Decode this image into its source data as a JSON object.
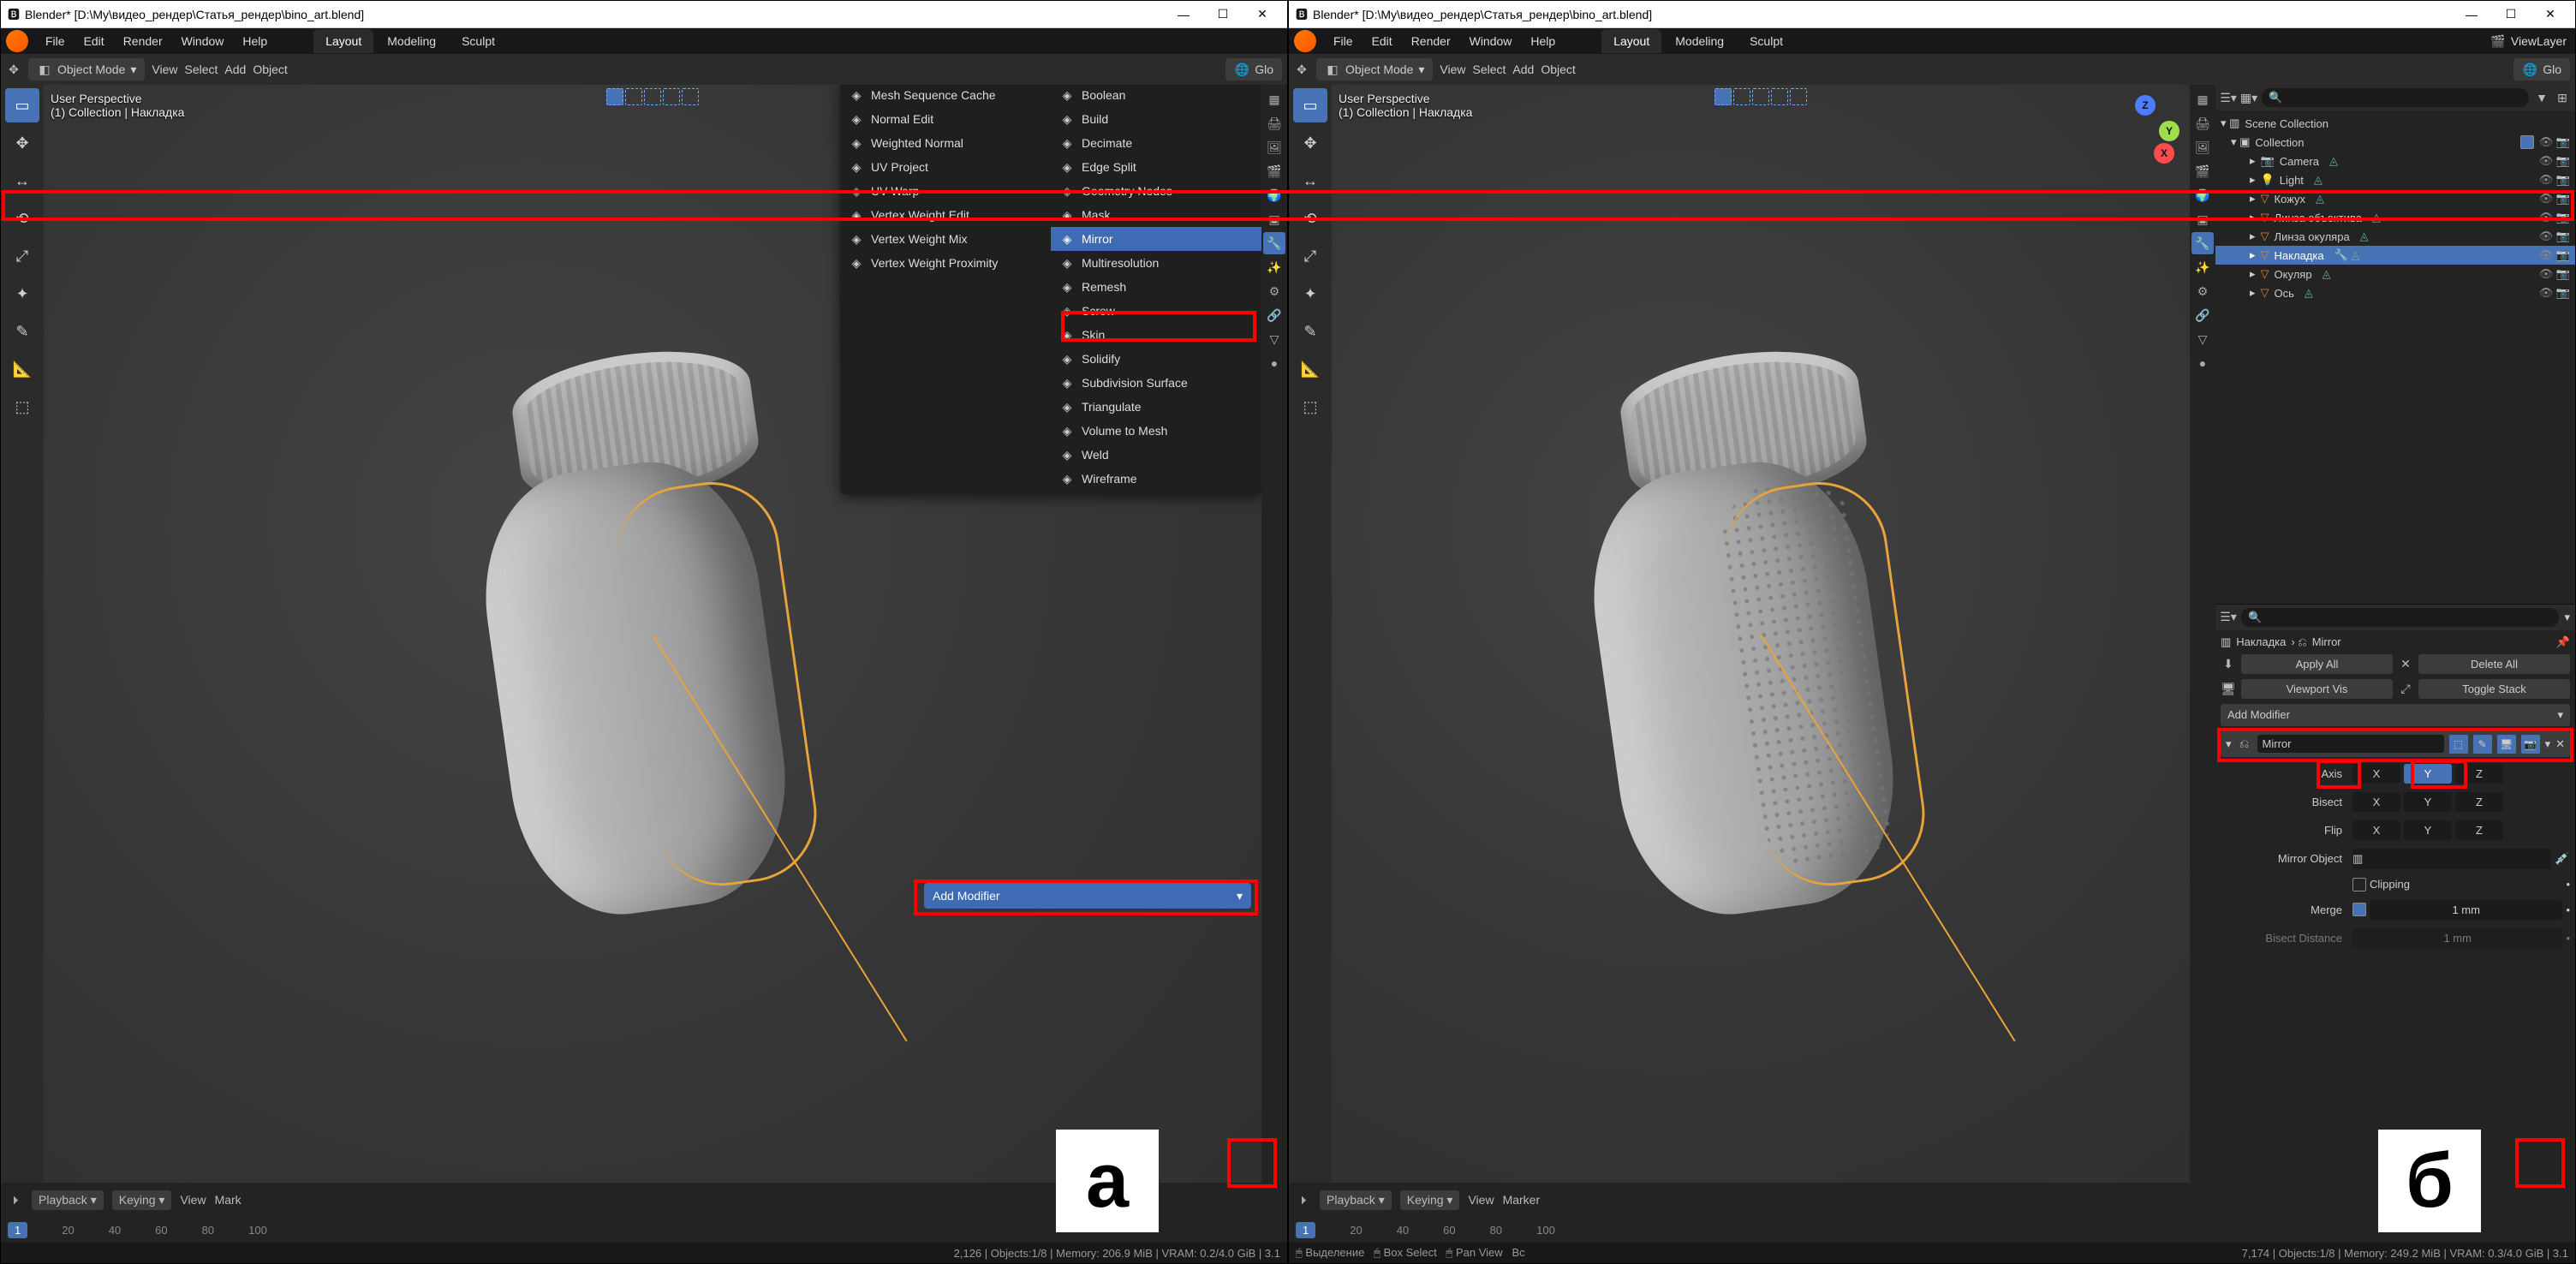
{
  "title": "Blender* [D:\\My\\видео_рендер\\Статья_рендер\\bino_art.blend]",
  "top_menu": {
    "file": "File",
    "edit": "Edit",
    "render": "Render",
    "window": "Window",
    "help": "Help"
  },
  "ws_tabs": {
    "layout": "Layout",
    "modeling": "Modeling",
    "sculpt": "Sculpt"
  },
  "hdr": {
    "mode": "Object Mode",
    "view": "View",
    "select": "Select",
    "add": "Add",
    "object": "Object",
    "global": "Glo"
  },
  "overlay": {
    "persp": "User Perspective",
    "coll": "(1) Collection | Накладка"
  },
  "modmenu_col1": [
    "Mesh Sequence Cache",
    "Normal Edit",
    "Weighted Normal",
    "UV Project",
    "UV Warp",
    "Vertex Weight Edit",
    "Vertex Weight Mix",
    "Vertex Weight Proximity"
  ],
  "modmenu_col2": [
    "Boolean",
    "Build",
    "Decimate",
    "Edge Split",
    "Geometry Nodes",
    "Mask",
    "Mirror",
    "Multiresolution",
    "Remesh",
    "Screw",
    "Skin",
    "Solidify",
    "Subdivision Surface",
    "Triangulate",
    "Volume to Mesh",
    "Weld",
    "Wireframe"
  ],
  "addmod": "Add Modifier",
  "timeline": {
    "playback": "Playback",
    "keying": "Keying",
    "view": "View",
    "marker": "Marker",
    "ticks": [
      "1",
      "20",
      "40",
      "60",
      "80",
      "100"
    ]
  },
  "statusL": {
    "a": "2,126",
    "b": "7,174",
    "common": "Objects:1/8 | Memory:",
    "memA": "206.9 MiB",
    "memB": "249.2 MiB",
    "vramA": "VRAM: 0.2/4.0 GiB",
    "vramB": "VRAM: 0.3/4.0 GiB",
    "ver": "3.1"
  },
  "statusRb": {
    "left": "Выделение",
    "right": "Box Select",
    "pan": "Pan View",
    "all": "Вс"
  },
  "outliner": {
    "scene": "Scene Collection",
    "coll": "Collection",
    "viewlayer": "ViewLayer",
    "search_ph": "",
    "items": [
      {
        "name": "Camera",
        "type": "cam"
      },
      {
        "name": "Light",
        "type": "light"
      },
      {
        "name": "Кожух",
        "type": "mesh"
      },
      {
        "name": "Линза объектива",
        "type": "mesh"
      },
      {
        "name": "Линза окуляра",
        "type": "mesh"
      },
      {
        "name": "Накладка",
        "type": "mesh",
        "sel": true
      },
      {
        "name": "Окуляр",
        "type": "mesh"
      },
      {
        "name": "Ось",
        "type": "mesh"
      }
    ]
  },
  "props": {
    "crumb_obj": "Накладка",
    "crumb_mod": "Mirror",
    "applyall": "Apply All",
    "deleteall": "Delete All",
    "viewportvis": "Viewport Vis",
    "toggle": "Toggle Stack",
    "addmod": "Add Modifier",
    "modname": "Mirror",
    "axis": "Axis",
    "bisect": "Bisect",
    "flip": "Flip",
    "mirrorobj": "Mirror Object",
    "clipping": "Clipping",
    "merge": "Merge",
    "merge_v": "1 mm",
    "bisectdist": "Bisect Distance",
    "bisectdist_v": "1 mm"
  },
  "labels": {
    "a": "а",
    "b": "б"
  }
}
